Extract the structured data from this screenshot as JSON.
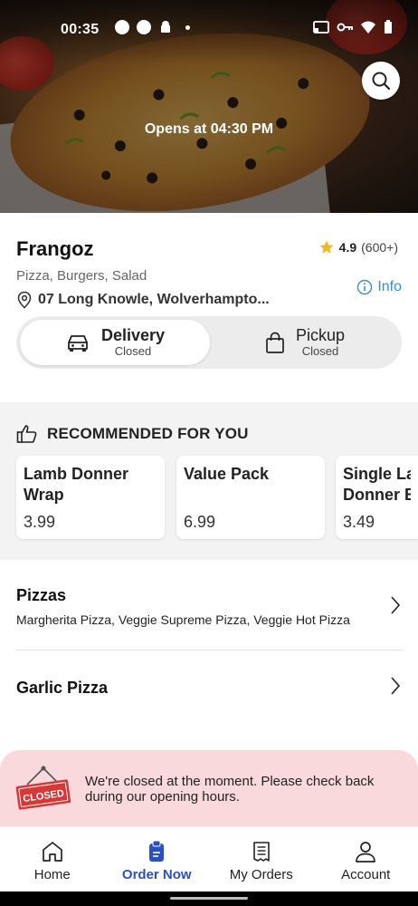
{
  "status_bar": {
    "time": "00:35"
  },
  "hero": {
    "opens_text": "Opens at 04:30 PM"
  },
  "restaurant": {
    "name": "Frangoz",
    "rating": "4.9",
    "rating_count": "(600+)",
    "cuisines": "Pizza, Burgers, Salad",
    "address": "07 Long Knowle, Wolverhampto...",
    "info_label": "Info"
  },
  "order_type": {
    "delivery": {
      "label": "Delivery",
      "status": "Closed"
    },
    "pickup": {
      "label": "Pickup",
      "status": "Closed"
    }
  },
  "recommended": {
    "heading": "RECOMMENDED FOR YOU",
    "items": [
      {
        "name": "Lamb Donner Wrap",
        "price": "3.99"
      },
      {
        "name": "Value Pack",
        "price": "6.99"
      },
      {
        "name": "Single Lamb Donner Burger",
        "price": "3.49"
      }
    ]
  },
  "categories": [
    {
      "title": "Pizzas",
      "description": "Margherita Pizza, Veggie Supreme Pizza, Veggie Hot Pizza"
    },
    {
      "title": "Garlic Pizza",
      "description": ""
    }
  ],
  "closed_banner": {
    "sign_text": "CLOSED",
    "message": "We're closed at the moment. Please check back during our opening hours."
  },
  "bottom_nav": {
    "items": [
      {
        "label": "Home",
        "icon": "home-icon",
        "active": false
      },
      {
        "label": "Order Now",
        "icon": "order-icon",
        "active": true
      },
      {
        "label": "My Orders",
        "icon": "receipt-icon",
        "active": false
      },
      {
        "label": "Account",
        "icon": "account-icon",
        "active": false
      }
    ]
  },
  "colors": {
    "accent_blue": "#2a4fc4",
    "info_blue": "#3a8ccf",
    "star": "#f2b824",
    "closed_bg": "#f9d9dc"
  }
}
